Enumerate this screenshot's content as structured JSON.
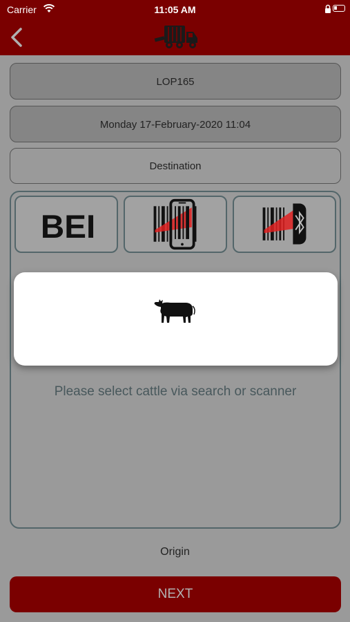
{
  "status_bar": {
    "carrier": "Carrier",
    "time": "11:05 AM"
  },
  "nav": {
    "back_icon": "chevron-left-icon",
    "logo_icon": "truck-icon"
  },
  "fields": {
    "vehicle": "LOP165",
    "datetime": "Monday 17-February-2020 11:04",
    "destination": "Destination"
  },
  "scan_options": [
    {
      "icon": "bei-text-icon",
      "text": "BEI"
    },
    {
      "icon": "phone-barcode-scanner-icon"
    },
    {
      "icon": "bluetooth-barcode-scanner-icon"
    }
  ],
  "cattle_card": {
    "icon": "cow-icon"
  },
  "hint": "Please select cattle via search or scanner",
  "origin": "Origin",
  "next_button": "NEXT",
  "colors": {
    "brand": "#7a0000",
    "accent": "#e02020",
    "overlay_bg": "#9a9a9a"
  }
}
